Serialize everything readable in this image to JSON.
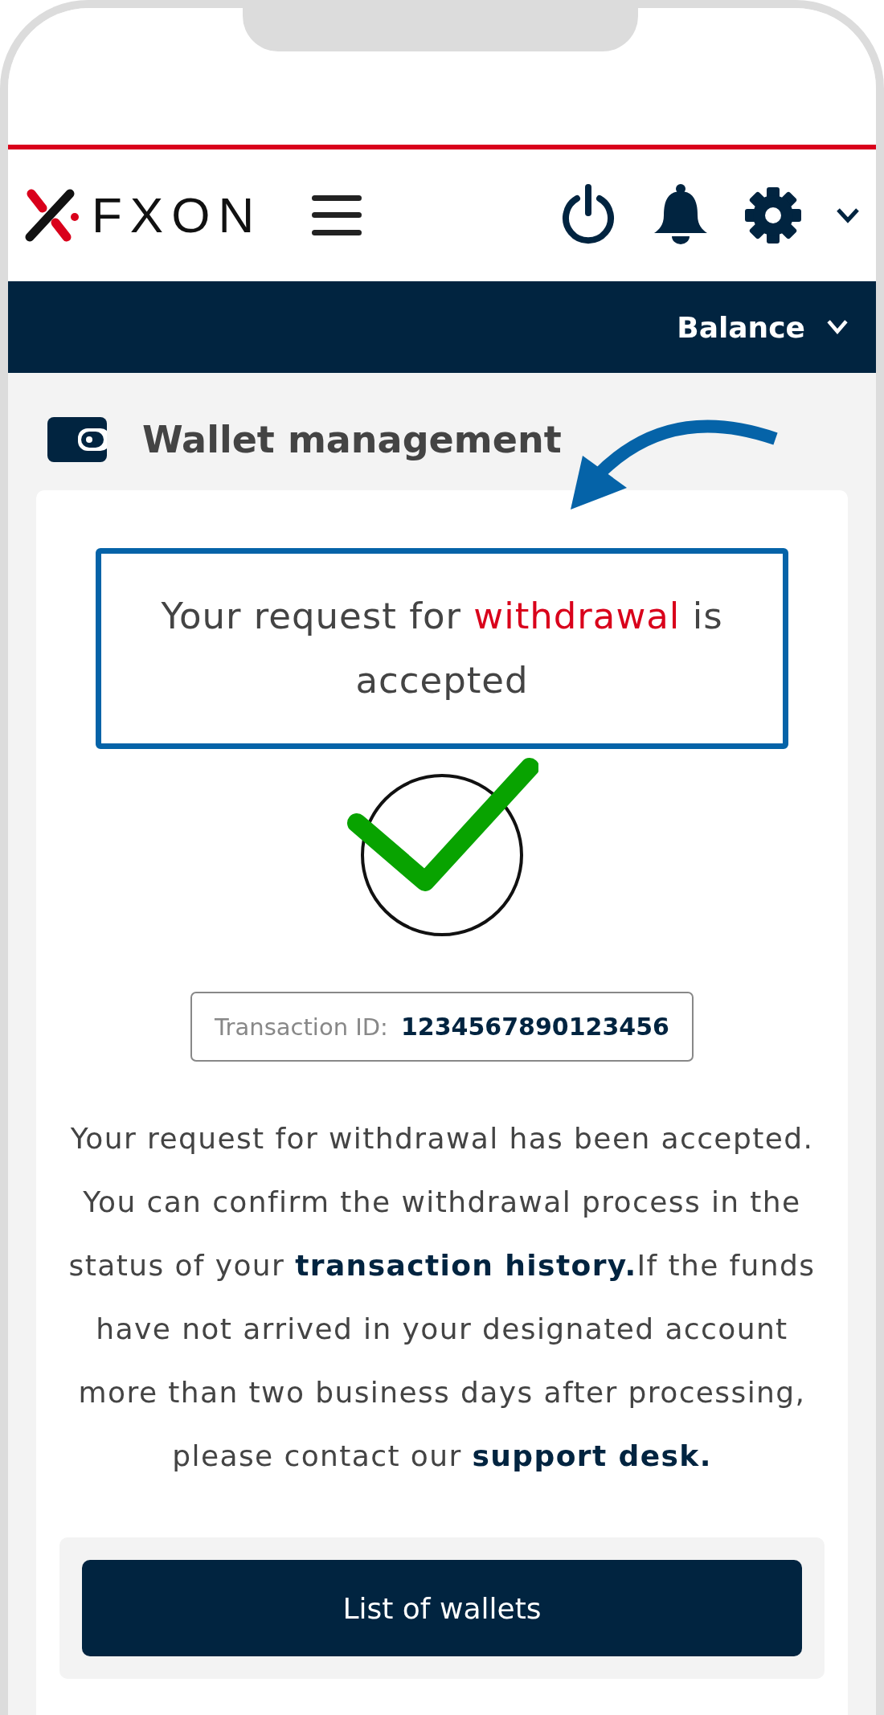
{
  "header": {
    "logo_text": "FXON"
  },
  "nav_bar": {
    "label": "Balance"
  },
  "page_title": "Wallet management",
  "callout": {
    "segments": [
      {
        "text": "Your request for ",
        "highlight": false
      },
      {
        "text": "withdrawal",
        "highlight": true
      },
      {
        "text": " is accepted",
        "highlight": false
      }
    ]
  },
  "transaction": {
    "label": "Transaction ID:",
    "value": "1234567890123456"
  },
  "message": [
    {
      "kind": "text",
      "text": "Your request for withdrawal has been accepted. You can confirm the withdrawal process in the status of your "
    },
    {
      "kind": "link",
      "text": "transaction history."
    },
    {
      "kind": "text",
      "text": "If the funds have not arrived in your designated account more than two business days after processing, please contact our "
    },
    {
      "kind": "link",
      "text": "support desk."
    }
  ],
  "button": {
    "label": "List of wallets"
  }
}
